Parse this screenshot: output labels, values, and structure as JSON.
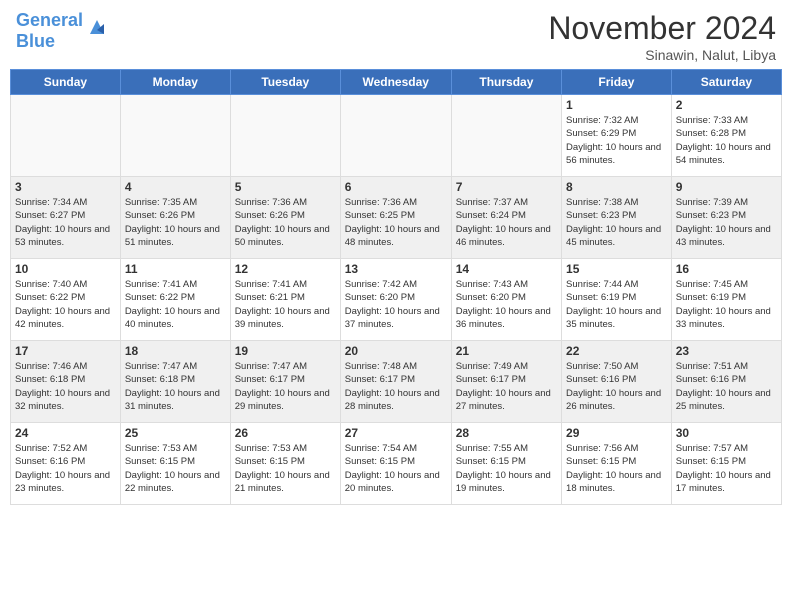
{
  "header": {
    "logo_text1": "General",
    "logo_text2": "Blue",
    "month_title": "November 2024",
    "location": "Sinawin, Nalut, Libya"
  },
  "days_of_week": [
    "Sunday",
    "Monday",
    "Tuesday",
    "Wednesday",
    "Thursday",
    "Friday",
    "Saturday"
  ],
  "weeks": [
    [
      {
        "day": "",
        "info": ""
      },
      {
        "day": "",
        "info": ""
      },
      {
        "day": "",
        "info": ""
      },
      {
        "day": "",
        "info": ""
      },
      {
        "day": "",
        "info": ""
      },
      {
        "day": "1",
        "info": "Sunrise: 7:32 AM\nSunset: 6:29 PM\nDaylight: 10 hours and 56 minutes."
      },
      {
        "day": "2",
        "info": "Sunrise: 7:33 AM\nSunset: 6:28 PM\nDaylight: 10 hours and 54 minutes."
      }
    ],
    [
      {
        "day": "3",
        "info": "Sunrise: 7:34 AM\nSunset: 6:27 PM\nDaylight: 10 hours and 53 minutes."
      },
      {
        "day": "4",
        "info": "Sunrise: 7:35 AM\nSunset: 6:26 PM\nDaylight: 10 hours and 51 minutes."
      },
      {
        "day": "5",
        "info": "Sunrise: 7:36 AM\nSunset: 6:26 PM\nDaylight: 10 hours and 50 minutes."
      },
      {
        "day": "6",
        "info": "Sunrise: 7:36 AM\nSunset: 6:25 PM\nDaylight: 10 hours and 48 minutes."
      },
      {
        "day": "7",
        "info": "Sunrise: 7:37 AM\nSunset: 6:24 PM\nDaylight: 10 hours and 46 minutes."
      },
      {
        "day": "8",
        "info": "Sunrise: 7:38 AM\nSunset: 6:23 PM\nDaylight: 10 hours and 45 minutes."
      },
      {
        "day": "9",
        "info": "Sunrise: 7:39 AM\nSunset: 6:23 PM\nDaylight: 10 hours and 43 minutes."
      }
    ],
    [
      {
        "day": "10",
        "info": "Sunrise: 7:40 AM\nSunset: 6:22 PM\nDaylight: 10 hours and 42 minutes."
      },
      {
        "day": "11",
        "info": "Sunrise: 7:41 AM\nSunset: 6:22 PM\nDaylight: 10 hours and 40 minutes."
      },
      {
        "day": "12",
        "info": "Sunrise: 7:41 AM\nSunset: 6:21 PM\nDaylight: 10 hours and 39 minutes."
      },
      {
        "day": "13",
        "info": "Sunrise: 7:42 AM\nSunset: 6:20 PM\nDaylight: 10 hours and 37 minutes."
      },
      {
        "day": "14",
        "info": "Sunrise: 7:43 AM\nSunset: 6:20 PM\nDaylight: 10 hours and 36 minutes."
      },
      {
        "day": "15",
        "info": "Sunrise: 7:44 AM\nSunset: 6:19 PM\nDaylight: 10 hours and 35 minutes."
      },
      {
        "day": "16",
        "info": "Sunrise: 7:45 AM\nSunset: 6:19 PM\nDaylight: 10 hours and 33 minutes."
      }
    ],
    [
      {
        "day": "17",
        "info": "Sunrise: 7:46 AM\nSunset: 6:18 PM\nDaylight: 10 hours and 32 minutes."
      },
      {
        "day": "18",
        "info": "Sunrise: 7:47 AM\nSunset: 6:18 PM\nDaylight: 10 hours and 31 minutes."
      },
      {
        "day": "19",
        "info": "Sunrise: 7:47 AM\nSunset: 6:17 PM\nDaylight: 10 hours and 29 minutes."
      },
      {
        "day": "20",
        "info": "Sunrise: 7:48 AM\nSunset: 6:17 PM\nDaylight: 10 hours and 28 minutes."
      },
      {
        "day": "21",
        "info": "Sunrise: 7:49 AM\nSunset: 6:17 PM\nDaylight: 10 hours and 27 minutes."
      },
      {
        "day": "22",
        "info": "Sunrise: 7:50 AM\nSunset: 6:16 PM\nDaylight: 10 hours and 26 minutes."
      },
      {
        "day": "23",
        "info": "Sunrise: 7:51 AM\nSunset: 6:16 PM\nDaylight: 10 hours and 25 minutes."
      }
    ],
    [
      {
        "day": "24",
        "info": "Sunrise: 7:52 AM\nSunset: 6:16 PM\nDaylight: 10 hours and 23 minutes."
      },
      {
        "day": "25",
        "info": "Sunrise: 7:53 AM\nSunset: 6:15 PM\nDaylight: 10 hours and 22 minutes."
      },
      {
        "day": "26",
        "info": "Sunrise: 7:53 AM\nSunset: 6:15 PM\nDaylight: 10 hours and 21 minutes."
      },
      {
        "day": "27",
        "info": "Sunrise: 7:54 AM\nSunset: 6:15 PM\nDaylight: 10 hours and 20 minutes."
      },
      {
        "day": "28",
        "info": "Sunrise: 7:55 AM\nSunset: 6:15 PM\nDaylight: 10 hours and 19 minutes."
      },
      {
        "day": "29",
        "info": "Sunrise: 7:56 AM\nSunset: 6:15 PM\nDaylight: 10 hours and 18 minutes."
      },
      {
        "day": "30",
        "info": "Sunrise: 7:57 AM\nSunset: 6:15 PM\nDaylight: 10 hours and 17 minutes."
      }
    ]
  ]
}
